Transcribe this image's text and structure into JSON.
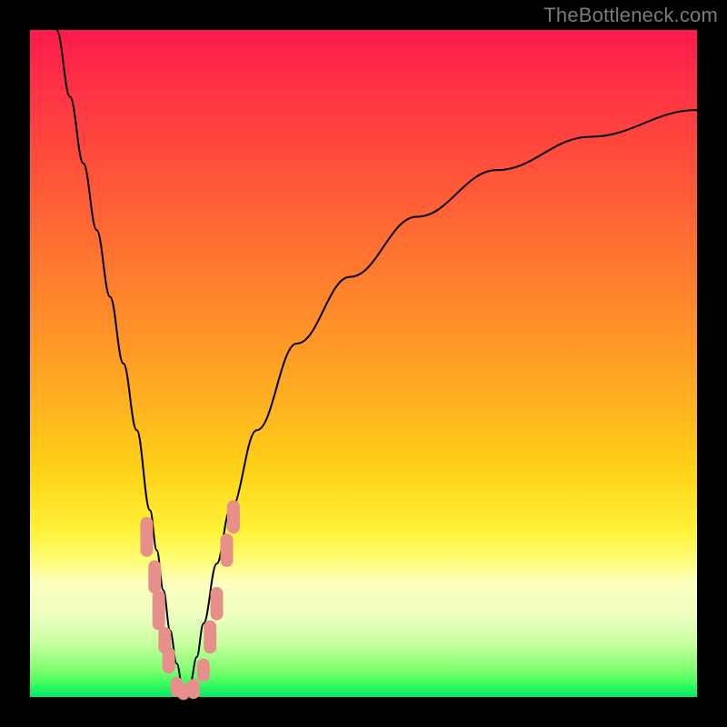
{
  "watermark": "TheBottleneck.com",
  "colors": {
    "frame": "#000000",
    "curve": "#000000",
    "marker": "#e78f8b",
    "gradient_top": "#ff1a4c",
    "gradient_mid": "#ffd217",
    "gradient_bottom": "#00e865"
  },
  "chart_data": {
    "type": "line",
    "title": "",
    "xlabel": "",
    "ylabel": "",
    "xlim": [
      0,
      100
    ],
    "ylim": [
      0,
      100
    ],
    "grid": false,
    "legend": false,
    "description": "Bottleneck curve: V-shaped; steep left branch from top-left down to trough near x≈23, shallower right branch rising asymptotically toward x=100. Trough touches y≈0 (green band).",
    "trough_x": 23,
    "series": [
      {
        "name": "bottleneck-curve",
        "x": [
          4,
          6,
          8,
          10,
          12,
          14,
          16,
          18,
          19,
          20,
          21,
          22,
          23,
          24,
          25,
          26,
          28,
          30,
          34,
          40,
          48,
          58,
          70,
          84,
          100
        ],
        "y": [
          100,
          90,
          80,
          70,
          60,
          50,
          40,
          28,
          22,
          16,
          10,
          5,
          0.8,
          2,
          6,
          11,
          20,
          28,
          40,
          53,
          63,
          72,
          79,
          84,
          88
        ]
      }
    ],
    "markers": {
      "name": "highlighted-points",
      "shape": "rounded-vertical-pill",
      "color": "#e78f8b",
      "points": [
        {
          "x": 17.5,
          "y": 24,
          "h": 6
        },
        {
          "x": 18.7,
          "y": 18,
          "h": 5
        },
        {
          "x": 19.3,
          "y": 13,
          "h": 6
        },
        {
          "x": 20.2,
          "y": 8.5,
          "h": 4
        },
        {
          "x": 20.8,
          "y": 5.5,
          "h": 4
        },
        {
          "x": 22.0,
          "y": 1.5,
          "h": 3
        },
        {
          "x": 23.0,
          "y": 0.8,
          "h": 2.5
        },
        {
          "x": 24.5,
          "y": 1.2,
          "h": 3
        },
        {
          "x": 26.0,
          "y": 4.0,
          "h": 3.5
        },
        {
          "x": 27.0,
          "y": 9.0,
          "h": 5
        },
        {
          "x": 28.0,
          "y": 14.0,
          "h": 5
        },
        {
          "x": 29.5,
          "y": 22.0,
          "h": 5
        },
        {
          "x": 30.5,
          "y": 27.0,
          "h": 5
        }
      ]
    }
  }
}
